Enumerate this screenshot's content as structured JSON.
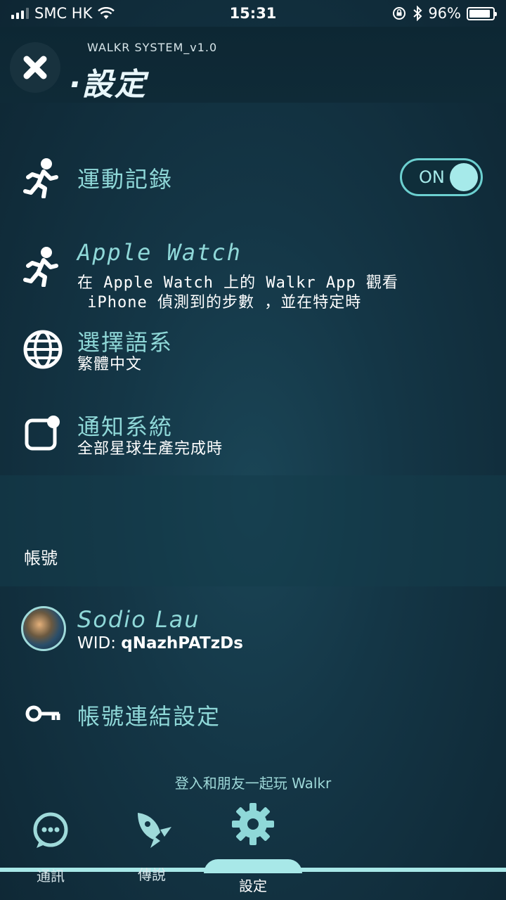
{
  "status_bar": {
    "carrier": "SMC HK",
    "time": "15:31",
    "battery": "96%"
  },
  "header": {
    "system_label": "WALKR SYSTEM_v1.0",
    "title": "·設定"
  },
  "settings": {
    "workout_record": {
      "label": "運動記錄",
      "toggle": "ON"
    },
    "apple_watch": {
      "label": "Apple Watch",
      "desc_line1": "在 Apple Watch 上的 Walkr App 觀看",
      "desc_line2": " iPhone 偵測到的步數 ，並在特定時"
    },
    "language": {
      "label": "選擇語系",
      "value": "繁體中文"
    },
    "notification": {
      "label": "通知系統",
      "value": "全部星球生產完成時"
    }
  },
  "account": {
    "section_title": "帳號",
    "name": "Sodio Lau",
    "wid_label": "WID: ",
    "wid_value": "qNazhPATzDs",
    "link_settings": "帳號連結設定",
    "login_prompt": "登入和朋友一起玩 Walkr"
  },
  "tabs": [
    {
      "label": "通訊",
      "icon": "chat-icon"
    },
    {
      "label": "傳說",
      "icon": "rocket-icon"
    },
    {
      "label": "設定",
      "icon": "gear-icon",
      "active": true
    }
  ],
  "colors": {
    "accent": "#8fd8d8",
    "background": "#143646"
  }
}
